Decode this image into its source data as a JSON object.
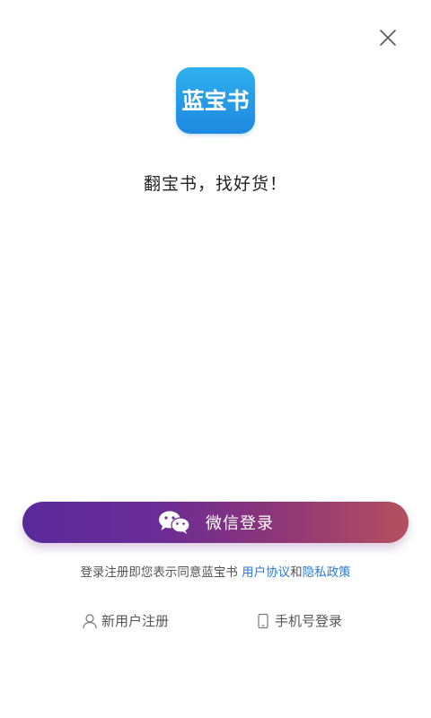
{
  "header": {
    "close_icon": "close-icon"
  },
  "logo": {
    "text": "蓝宝书",
    "colors": {
      "top": "#2fb0ee",
      "bottom": "#1e88e0"
    }
  },
  "slogan": "翻宝书，找好货！",
  "wechat_login": {
    "label": "微信登录",
    "icon": "wechat-icon",
    "gradient": [
      "#5a2a9a",
      "#6a2c96",
      "#8c3578",
      "#b5505e"
    ]
  },
  "agreement": {
    "prefix": "登录注册即您表示同意蓝宝书 ",
    "user_agreement": "用户协议",
    "conjunction": "和",
    "privacy_policy": "隐私政策",
    "link_color": "#2a7ad6"
  },
  "bottom_links": {
    "register": {
      "label": "新用户注册",
      "icon": "user-icon"
    },
    "phone_login": {
      "label": "手机号登录",
      "icon": "phone-icon"
    }
  }
}
